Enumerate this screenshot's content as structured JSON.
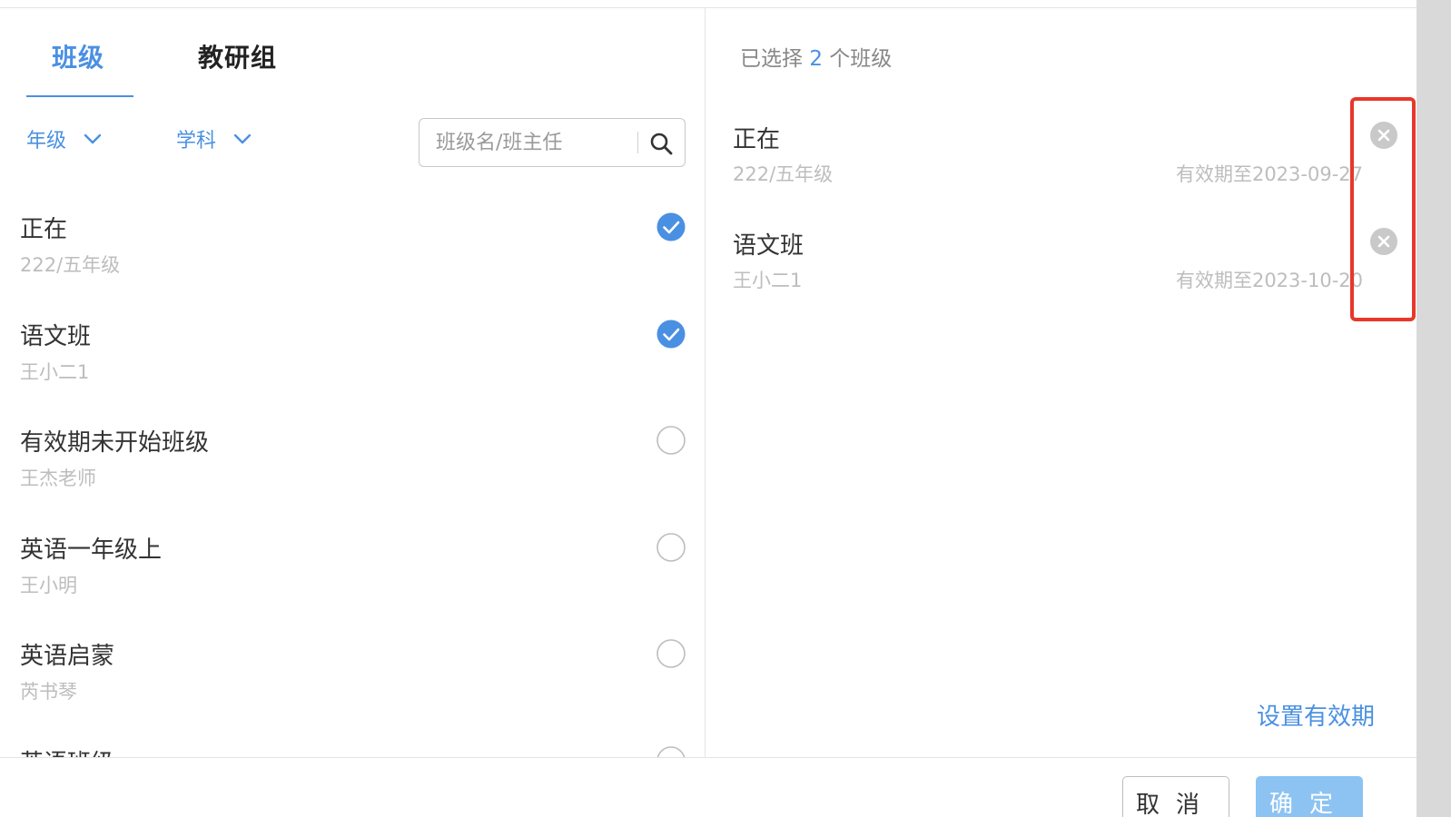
{
  "tabs": {
    "class": "班级",
    "group": "教研组"
  },
  "filters": {
    "grade": "年级",
    "subject": "学科"
  },
  "search": {
    "placeholder": "班级名/班主任"
  },
  "class_list": [
    {
      "name": "正在",
      "sub": "222/五年级",
      "checked": true
    },
    {
      "name": "语文班",
      "sub": "王小二1",
      "checked": true
    },
    {
      "name": "有效期未开始班级",
      "sub": "王杰老师",
      "checked": false
    },
    {
      "name": "英语一年级上",
      "sub": "王小明",
      "checked": false
    },
    {
      "name": "英语启蒙",
      "sub": "芮书琴",
      "checked": false
    },
    {
      "name": "英语班级",
      "sub": "",
      "checked": false
    }
  ],
  "selected": {
    "prefix": "已选择",
    "count": "2",
    "suffix": "个班级",
    "items": [
      {
        "name": "正在",
        "sub": "222/五年级",
        "expire": "有效期至2023-09-27"
      },
      {
        "name": "语文班",
        "sub": "王小二1",
        "expire": "有效期至2023-10-20"
      }
    ],
    "set_validity": "设置有效期"
  },
  "footer": {
    "cancel": "取消",
    "ok": "确定"
  },
  "colors": {
    "accent": "#4a90e2",
    "highlight": "#e8372a",
    "ok_button": "#8cc3f2"
  }
}
